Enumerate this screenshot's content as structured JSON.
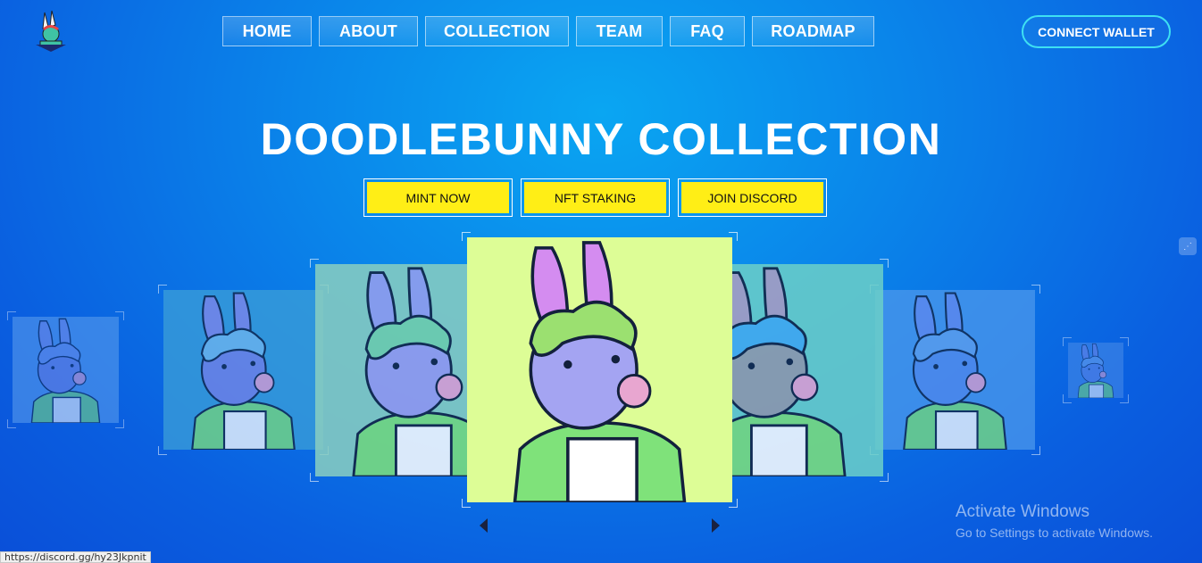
{
  "nav": {
    "items": [
      {
        "label": "HOME"
      },
      {
        "label": "ABOUT"
      },
      {
        "label": "COLLECTION"
      },
      {
        "label": "TEAM"
      },
      {
        "label": "FAQ"
      },
      {
        "label": "ROADMAP"
      }
    ],
    "connect_label": "CONNECT WALLET",
    "logo_icon": "doodlebunny-logo-icon"
  },
  "hero": {
    "title": "DOODLEBUNNY COLLECTION",
    "buttons": [
      {
        "label": "MINT NOW"
      },
      {
        "label": "NFT STAKING"
      },
      {
        "label": "JOIN DISCORD"
      }
    ]
  },
  "carousel": {
    "cards": [
      {
        "name": "bunny-card-far-left",
        "bg": "#5fa0ee",
        "head": "#7d8de8",
        "hair": "#7d9cf0",
        "ears": "#8899ee"
      },
      {
        "name": "bunny-card-left",
        "bg": "#3c9fd8",
        "head": "#7d88e6",
        "hair": "#7ac0ec",
        "ears": "#8a8de8"
      },
      {
        "name": "bunny-card-near-left",
        "bg": "#8bcfc0",
        "head": "#a0a0ee",
        "hair": "#7bd6a8",
        "ears": "#9aa0ee"
      },
      {
        "name": "bunny-card-center",
        "bg": "#ddfd96",
        "head": "#a4a4f2",
        "hair": "#9be070",
        "ears": "#d48cf0"
      },
      {
        "name": "bunny-card-near-right",
        "bg": "#6cd0c8",
        "head": "#9aa0a8",
        "hair": "#4ab0ee",
        "ears": "#b0a0c0"
      },
      {
        "name": "bunny-card-right",
        "bg": "#4c98ec",
        "head": "#5d90ee",
        "hair": "#6aa6ef",
        "ears": "#6f8ff0"
      },
      {
        "name": "bunny-card-far-right",
        "bg": "#4b8ce8",
        "head": "#6b8cea",
        "hair": "#76a8ee",
        "ears": "#7d8eea"
      }
    ],
    "prev_icon": "chevron-left-icon",
    "next_icon": "chevron-right-icon"
  },
  "system": {
    "activate_title": "Activate Windows",
    "activate_sub": "Go to Settings to activate Windows.",
    "status_url": "https://discord.gg/hy23Jkpnit",
    "side_widget_icon": "chat-widget-icon"
  }
}
